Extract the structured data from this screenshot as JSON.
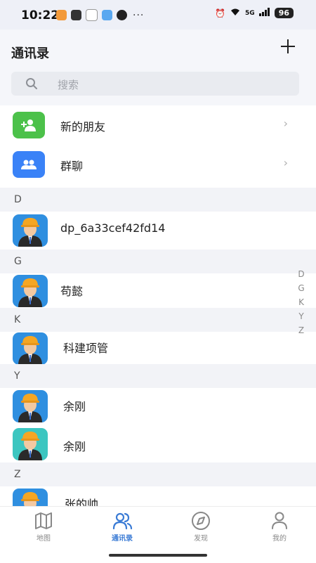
{
  "status_bar": {
    "time": "10:22",
    "battery": "96",
    "network": "5G"
  },
  "header": {
    "title": "通讯录",
    "add_icon": "plus-icon"
  },
  "search": {
    "placeholder": "搜索"
  },
  "top_entries": [
    {
      "label": "新的朋友",
      "icon": "add-user-icon",
      "color": "#4cc14a"
    },
    {
      "label": "群聊",
      "icon": "group-icon",
      "color": "#3a82f7"
    }
  ],
  "sections": [
    {
      "letter": "D",
      "contacts": [
        "dp_6a33cef42fd14"
      ]
    },
    {
      "letter": "G",
      "contacts": [
        "苟懿"
      ]
    },
    {
      "letter": "K",
      "contacts": [
        "科建项管"
      ]
    },
    {
      "letter": "Y",
      "contacts": [
        "余刚",
        "余刚"
      ]
    },
    {
      "letter": "Z",
      "contacts": [
        "张的帅"
      ]
    }
  ],
  "index_letters": [
    "D",
    "G",
    "K",
    "Y",
    "Z"
  ],
  "tabs": [
    {
      "label": "地图",
      "icon": "map-icon",
      "active": false
    },
    {
      "label": "通讯录",
      "icon": "contacts-icon",
      "active": true
    },
    {
      "label": "发现",
      "icon": "compass-icon",
      "active": false
    },
    {
      "label": "我的",
      "icon": "profile-icon",
      "active": false
    }
  ],
  "colors": {
    "accent": "#3a7bd5",
    "section_bg": "#f2f3f7"
  }
}
